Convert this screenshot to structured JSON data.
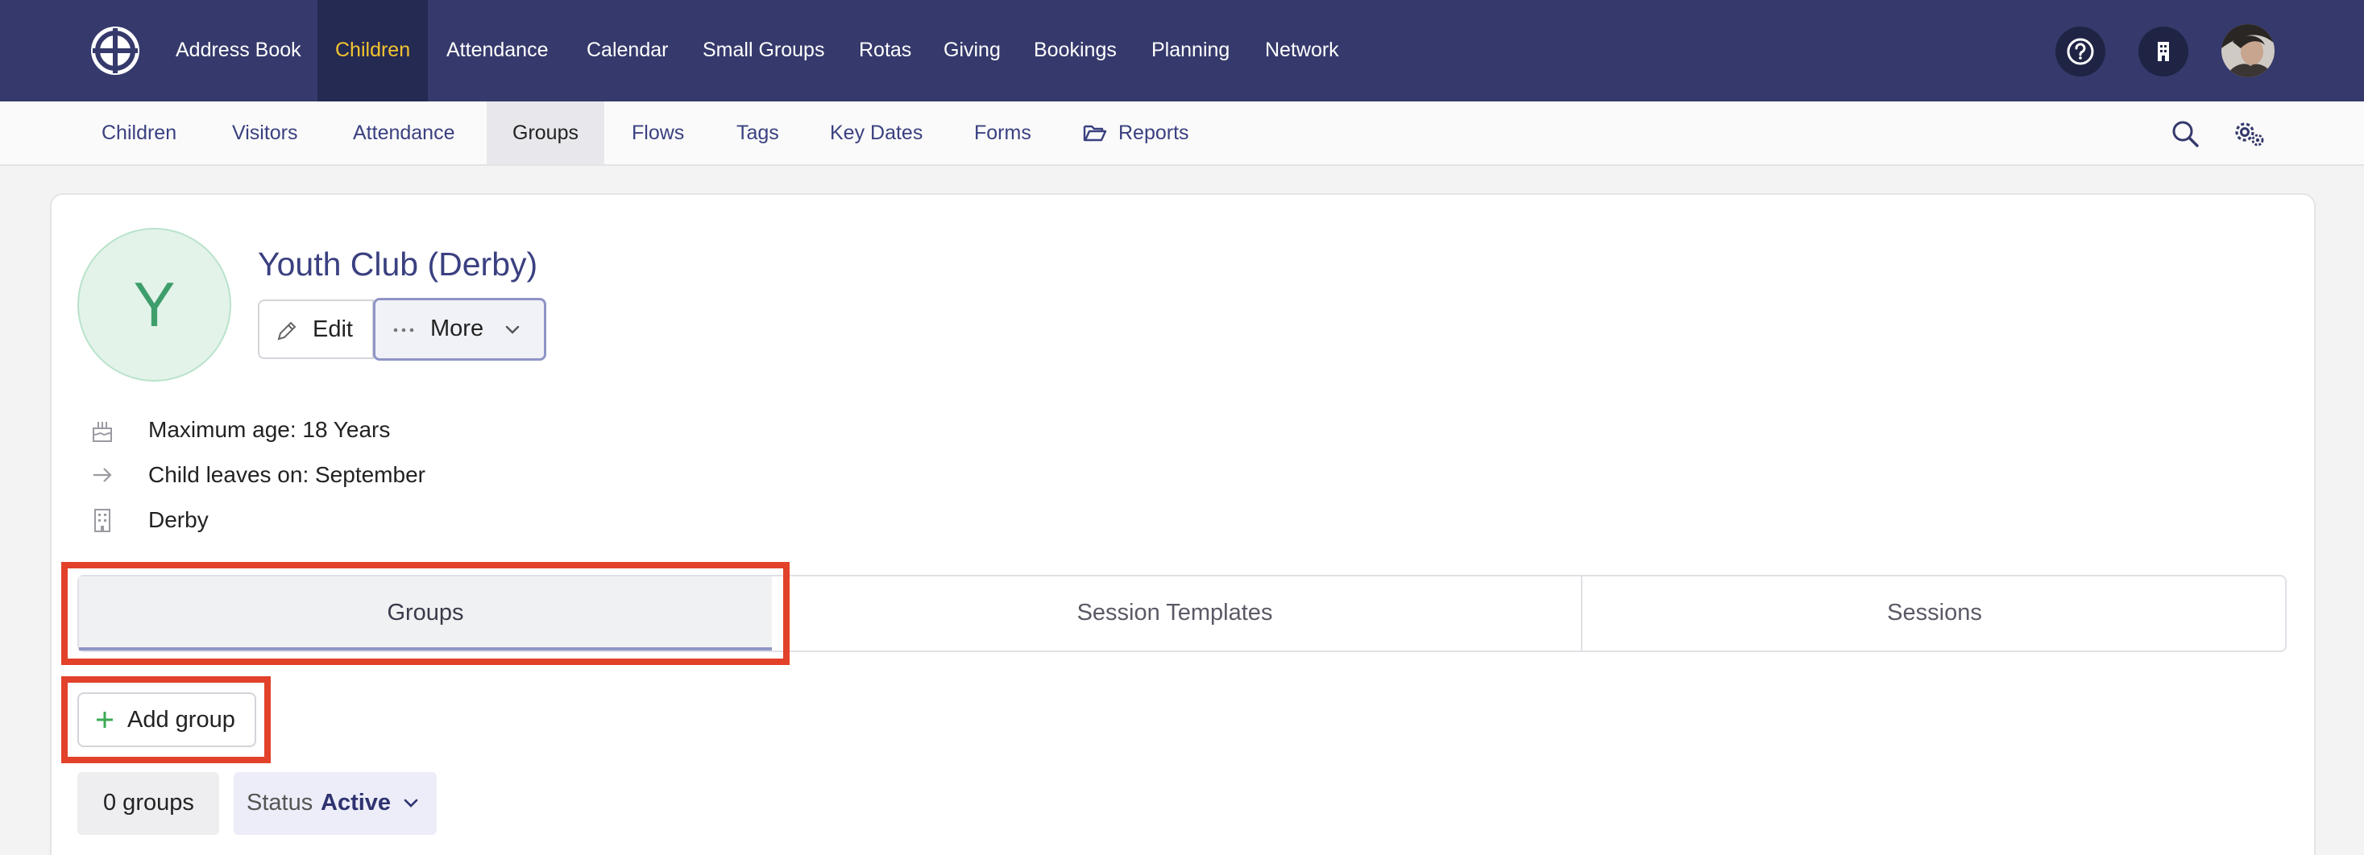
{
  "topnav": {
    "items": [
      "Address Book",
      "Children",
      "Attendance",
      "Calendar",
      "Small Groups",
      "Rotas",
      "Giving",
      "Bookings",
      "Planning",
      "Network"
    ],
    "active": "Children",
    "icons": [
      "help-icon",
      "building-icon"
    ]
  },
  "subnav": {
    "items": [
      "Children",
      "Visitors",
      "Attendance",
      "Groups",
      "Flows",
      "Tags",
      "Key Dates",
      "Forms",
      "Reports"
    ],
    "active": "Groups",
    "icons": [
      "search-icon",
      "settings-icon"
    ]
  },
  "group": {
    "avatar_letter": "Y",
    "title": "Youth Club (Derby)",
    "edit_label": "Edit",
    "more_label": "More",
    "details": [
      {
        "icon": "cake-icon",
        "text": "Maximum age: 18 Years"
      },
      {
        "icon": "arrow-right-icon",
        "text": "Child leaves on: September"
      },
      {
        "icon": "building-icon",
        "text": "Derby"
      }
    ]
  },
  "tabs": {
    "items": [
      "Groups",
      "Session Templates",
      "Sessions"
    ],
    "active": "Groups"
  },
  "actions": {
    "add_group_label": "Add group"
  },
  "filters": {
    "count_label": "0 groups",
    "status_label": "Status",
    "status_value": "Active"
  },
  "colors": {
    "topbar": "#35396b",
    "active_nav_text": "#f4c430",
    "link": "#3a4080",
    "highlight": "#e2412a",
    "add_icon": "#3aaa55",
    "avatar_bg": "#e3f3ea",
    "avatar_text": "#3e9e6b"
  }
}
